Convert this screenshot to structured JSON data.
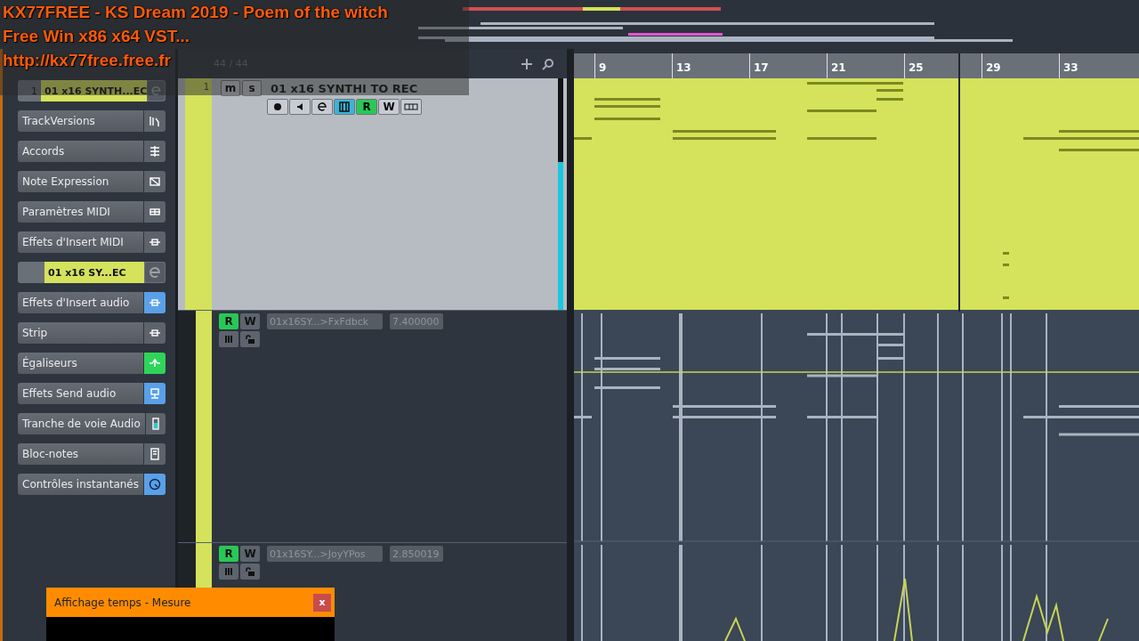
{
  "overlay": {
    "lines": [
      "KX77FREE - KS Dream 2019 - Poem of the witch",
      "Free Win x86 x64 VST...",
      "http://kx77free.free.fr"
    ]
  },
  "inspector": [
    {
      "kind": "track",
      "number": "1",
      "name": "01 x16 SYNTH...EC"
    },
    {
      "kind": "versions",
      "label": "TrackVersions",
      "color": "#5d636b"
    },
    {
      "kind": "chords",
      "label": "Accords",
      "color": "#5d636b"
    },
    {
      "kind": "expression",
      "label": "Note Expression",
      "color": "#5d636b"
    },
    {
      "kind": "grid",
      "label": "Paramètres MIDI",
      "color": "#5d636b"
    },
    {
      "kind": "insert",
      "label": "Effets d'Insert MIDI",
      "color": "#5d636b"
    },
    {
      "kind": "track",
      "name": "01 x16 SY...EC"
    },
    {
      "kind": "insert",
      "label": "Effets d'Insert audio",
      "color": "#5aa0e8"
    },
    {
      "kind": "insert",
      "label": "Strip",
      "color": "#5d636b"
    },
    {
      "kind": "eq",
      "label": "Égaliseurs",
      "color": "#2fd55a"
    },
    {
      "kind": "send",
      "label": "Effets Send audio",
      "color": "#5aa0e8"
    },
    {
      "kind": "channel",
      "label": "Tranche de voie Audio",
      "color": "#5d636b"
    },
    {
      "kind": "notepad",
      "label": "Bloc-notes",
      "color": "#5d636b"
    },
    {
      "kind": "quick",
      "label": "Contrôles instantanés",
      "color": "#5aa0e8"
    }
  ],
  "tracklist": {
    "counter": "44 / 44",
    "instrument": {
      "number": "1",
      "name": "01 x16 SYNTHI TO REC",
      "meter": {
        "level": 0.64
      },
      "header_buttons": [
        {
          "label": "m",
          "on": false
        },
        {
          "label": "s",
          "on": false
        }
      ],
      "buttons": [
        {
          "kind": "record",
          "on": false
        },
        {
          "kind": "monitor",
          "on": false
        },
        {
          "kind": "edit",
          "on": false
        },
        {
          "kind": "keys",
          "on": true
        },
        {
          "kind": "text",
          "label": "R",
          "on": true
        },
        {
          "kind": "text",
          "label": "W",
          "on": false
        },
        {
          "kind": "lanes",
          "on": false
        }
      ]
    },
    "lanes": [
      {
        "read_label": "R",
        "read": true,
        "write_label": "W",
        "write": false,
        "parameter": "01x16SY...>FxFdbck",
        "value": "7.400000"
      },
      {
        "read_label": "R",
        "read": true,
        "write_label": "W",
        "write": false,
        "parameter": "01x16SY...>JoyYPos",
        "value": "2.850019"
      }
    ]
  },
  "ruler": {
    "bars": [
      "9",
      "13",
      "17",
      "21",
      "25",
      "29",
      "33"
    ]
  },
  "time_window": {
    "title": "Affichage temps - Mesure",
    "close": "x"
  }
}
